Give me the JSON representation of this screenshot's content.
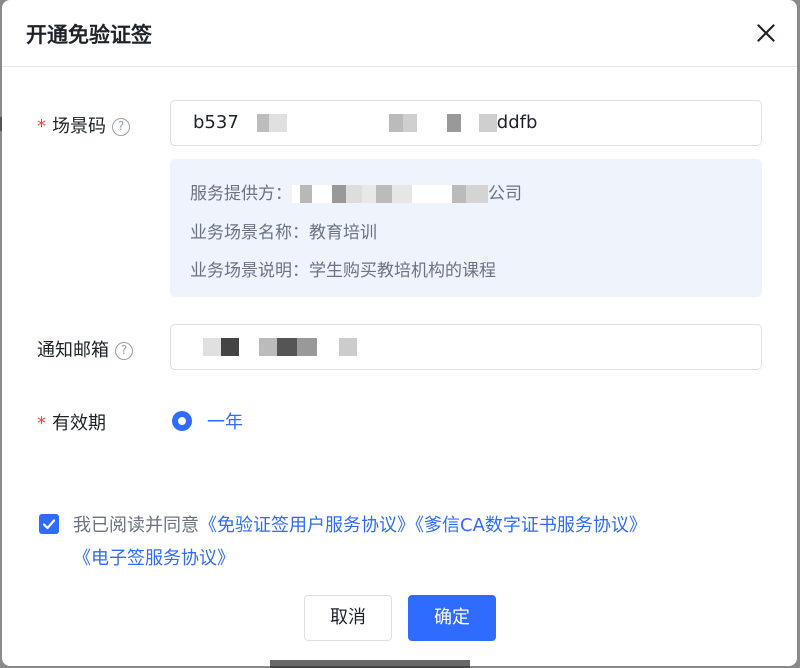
{
  "dialog": {
    "title": "开通免验证签",
    "close_icon": "close-icon"
  },
  "form": {
    "scene_code": {
      "label": "场景码",
      "required": true,
      "help_icon": "question-circle-icon",
      "value_prefix": "b537",
      "value_suffix": "ddfb"
    },
    "info": {
      "provider_label": "服务提供方：",
      "provider_value_suffix": "公司",
      "scene_name": "业务场景名称：教育培训",
      "scene_desc": "业务场景说明：学生购买教培机构的课程"
    },
    "email": {
      "label": "通知邮箱",
      "required": false,
      "help_icon": "question-circle-icon",
      "value": ""
    },
    "validity": {
      "label": "有效期",
      "required": true,
      "option": "一年",
      "selected": true
    }
  },
  "agreement": {
    "checked": true,
    "prefix": "我已阅读并同意",
    "link1": "《免验证签用户服务协议》",
    "link2": "《爹信CA数字证书服务协议》",
    "link3": "《电子签服务协议》"
  },
  "buttons": {
    "cancel": "取消",
    "confirm": "确定"
  },
  "colors": {
    "primary": "#2f6bff",
    "required": "#f53f3f",
    "info_bg": "#eef3fc"
  }
}
